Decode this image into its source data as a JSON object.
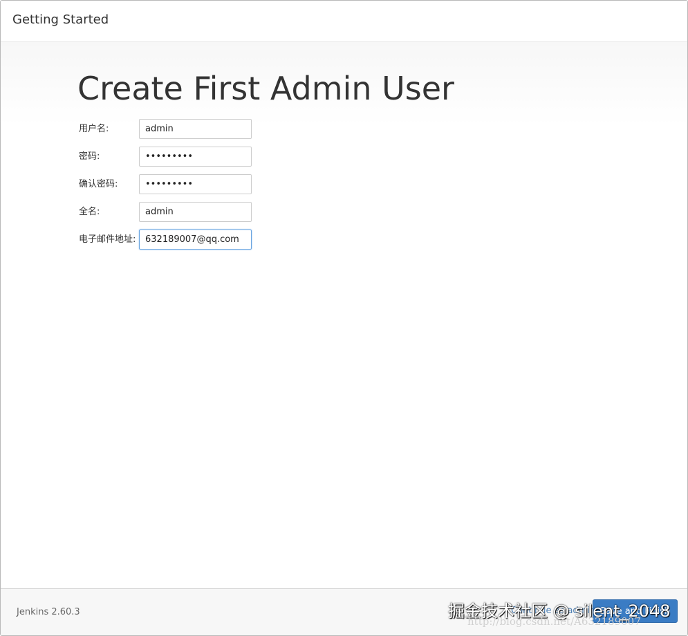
{
  "header": {
    "title": "Getting Started"
  },
  "page": {
    "heading": "Create First Admin User"
  },
  "form": {
    "fields": [
      {
        "label": "用户名:",
        "value": "admin",
        "type": "text"
      },
      {
        "label": "密码:",
        "value": "•••••••••",
        "type": "password"
      },
      {
        "label": "确认密码:",
        "value": "•••••••••",
        "type": "password"
      },
      {
        "label": "全名:",
        "value": "admin",
        "type": "text"
      },
      {
        "label": "电子邮件地址:",
        "value": "632189007@qq.com",
        "type": "text"
      }
    ]
  },
  "footer": {
    "version": "Jenkins 2.60.3",
    "continue_label": "Continue as admin",
    "save_label": "Save and Finish"
  },
  "watermark": {
    "main": "掘金技术社区 @ silent_2048",
    "url": "http://blog.csdn.net/A632189007"
  }
}
